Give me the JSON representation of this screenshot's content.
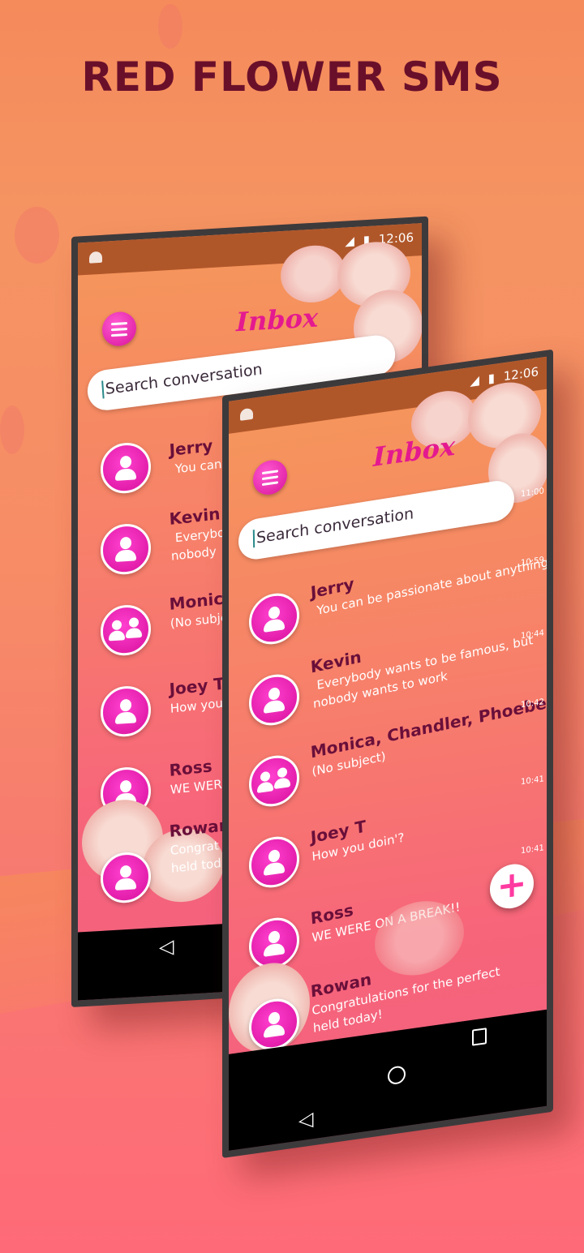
{
  "header": {
    "title": "RED FLOWER SMS"
  },
  "phone": {
    "status_time": "12:06",
    "inbox_title": "Inbox",
    "search_placeholder": "Search conversation",
    "conversations": [
      {
        "name": "Jerry",
        "preview": "You can be passionate about anything!",
        "time": "11:00",
        "avatar": "person-icon"
      },
      {
        "name": "Kevin",
        "preview": "Everybody wants to be famous, but nobody wants to work",
        "preview_line1": "Everybody wants to be famous, but",
        "preview_line2": "nobody wants to work",
        "time": "10:59",
        "avatar": "person-icon"
      },
      {
        "name": "Monica, Chandler, Phoebe",
        "preview": "(No subject)",
        "time": "10:44",
        "avatar": "group-icon"
      },
      {
        "name": "Joey T",
        "preview": "How you doin'?",
        "time": "10:42",
        "avatar": "person-icon"
      },
      {
        "name": "Ross",
        "preview": "WE WERE ON A BREAK!!",
        "time": "10:41",
        "avatar": "person-icon"
      },
      {
        "name": "Rowan",
        "preview_line1": "Congratulations for the perfect",
        "preview_line2": "held today!",
        "time": "10:41",
        "avatar": "person-icon"
      }
    ],
    "back_phone_partials": {
      "jerry": "You can",
      "kevin_1": "Everybo",
      "kevin_2": "nobody",
      "monica": "Monica",
      "monica_prev": "(No subje",
      "joey": "Joey T",
      "joey_prev": "How you",
      "ross": "Ross",
      "ross_prev": "WE WER",
      "rowan": "Rowan",
      "rowan_prev1": "Congrat",
      "rowan_prev2": "held tod"
    },
    "fab_label": "+",
    "nav": {
      "back": "◁",
      "home": "○",
      "recents": "□"
    }
  },
  "colors": {
    "accent": "#e4198f",
    "title": "#6a0f2a",
    "name": "#6a0f3a"
  }
}
